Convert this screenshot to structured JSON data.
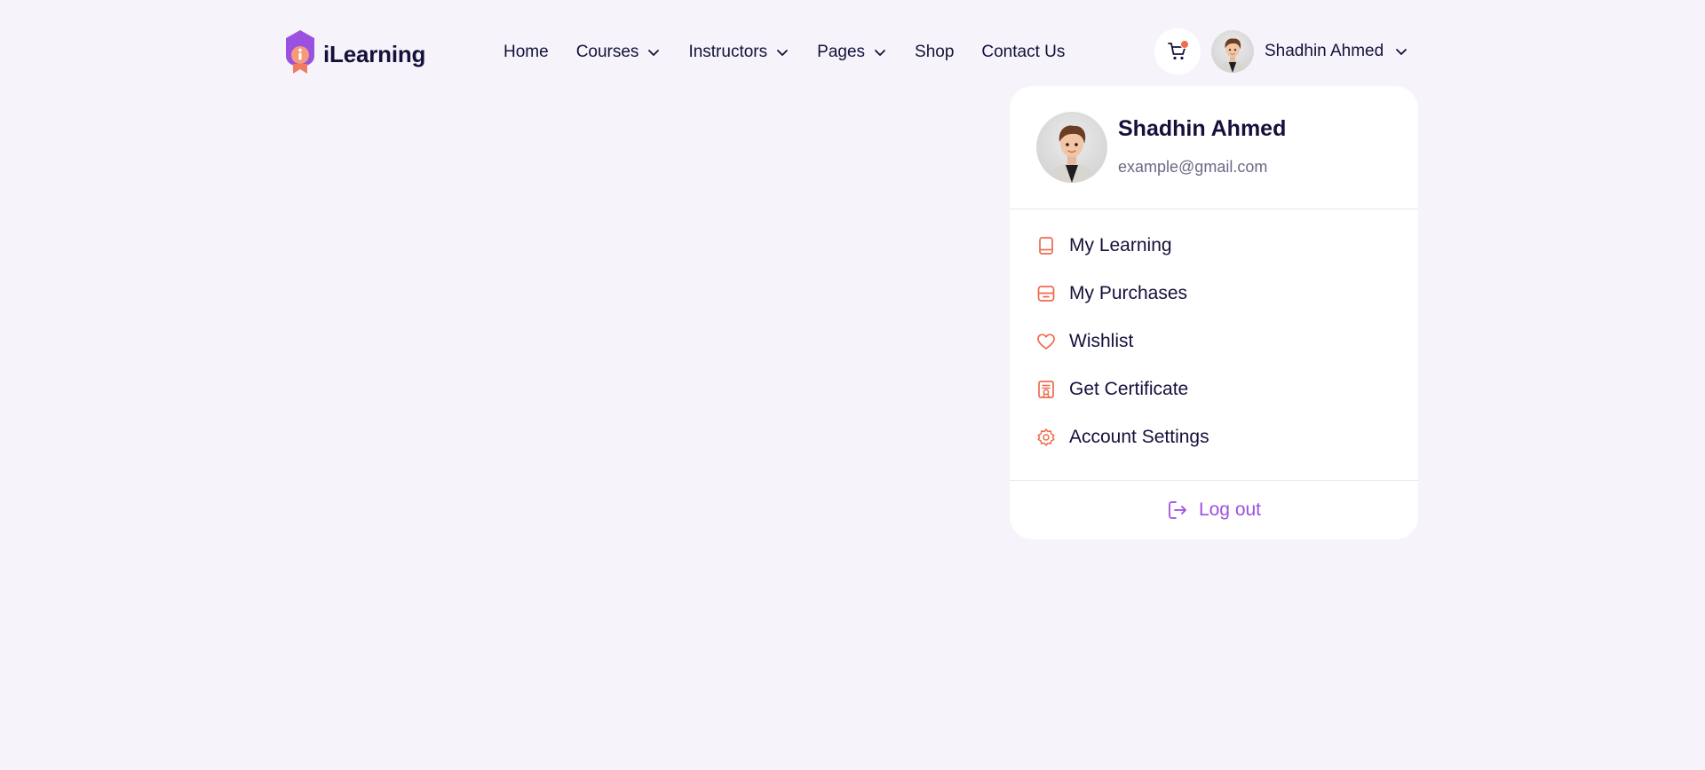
{
  "brand": {
    "name": "iLearning",
    "logo_icon": "shield-i-logo",
    "primary": "#9b51e0",
    "accent": "#f06a4e",
    "text": "#14113b"
  },
  "nav": {
    "items": [
      {
        "label": "Home",
        "has_dropdown": false
      },
      {
        "label": "Courses",
        "has_dropdown": true
      },
      {
        "label": "Instructors",
        "has_dropdown": true
      },
      {
        "label": "Pages",
        "has_dropdown": true
      },
      {
        "label": "Shop",
        "has_dropdown": false
      },
      {
        "label": "Contact Us",
        "has_dropdown": false
      }
    ]
  },
  "cart": {
    "icon": "cart-icon",
    "has_badge": true
  },
  "user": {
    "name": "Shadhin Ahmed",
    "email": "example@gmail.com"
  },
  "dropdown": {
    "items": [
      {
        "label": "My Learning",
        "icon": "book-icon"
      },
      {
        "label": "My Purchases",
        "icon": "purchases-icon"
      },
      {
        "label": "Wishlist",
        "icon": "heart-icon"
      },
      {
        "label": "Get Certificate",
        "icon": "certificate-icon"
      },
      {
        "label": "Account Settings",
        "icon": "gear-icon"
      }
    ],
    "logout_label": "Log out"
  }
}
